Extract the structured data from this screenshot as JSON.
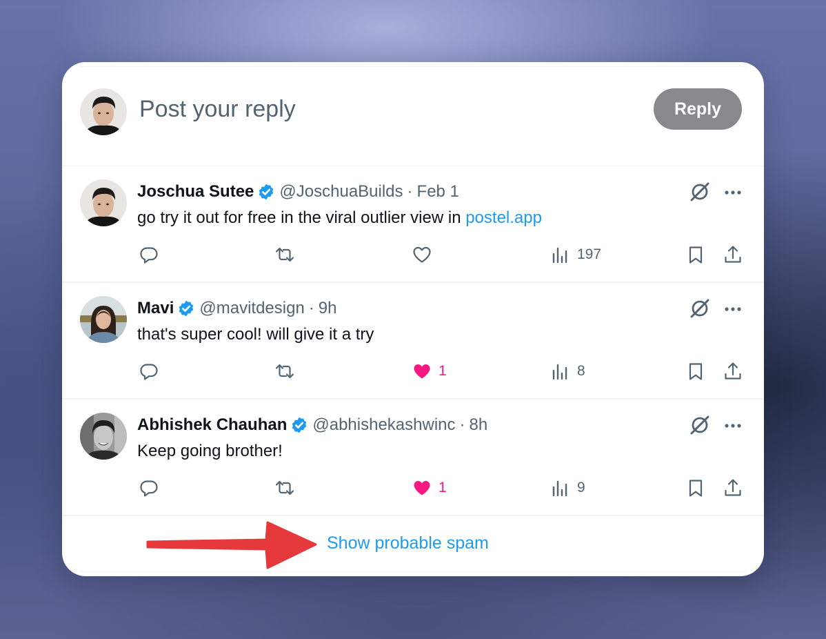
{
  "composer": {
    "placeholder": "Post your reply",
    "reply_label": "Reply"
  },
  "tweets": [
    {
      "name": "Joschua Sutee",
      "handle": "@JoschuaBuilds",
      "separator": "·",
      "time": "Feb 1",
      "text": "go try it out for free in the viral outlier view in ",
      "link": "postel.app",
      "likes": "",
      "liked": false,
      "views": "197"
    },
    {
      "name": "Mavi",
      "handle": "@mavitdesign",
      "separator": "·",
      "time": "9h",
      "text": "that's super cool! will give it a try",
      "link": "",
      "likes": "1",
      "liked": true,
      "views": "8"
    },
    {
      "name": "Abhishek Chauhan",
      "handle": "@abhishekashwinc",
      "separator": "·",
      "time": "8h",
      "text": "Keep going brother!",
      "link": "",
      "likes": "1",
      "liked": true,
      "views": "9"
    }
  ],
  "spam": {
    "label": "Show probable spam"
  },
  "colors": {
    "accent": "#1d9bf0",
    "like": "#f91880",
    "secondary_text": "#536471",
    "reply_button": "#87898c",
    "arrow": "#e5393b"
  },
  "icons": [
    "reply-icon",
    "retweet-icon",
    "like-icon",
    "views-icon",
    "bookmark-icon",
    "share-icon",
    "grok-icon",
    "more-icon",
    "verified-icon"
  ]
}
